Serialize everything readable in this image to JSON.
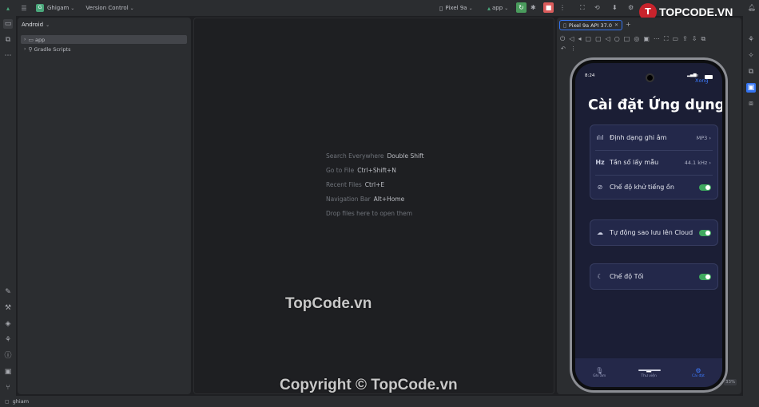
{
  "titlebar": {
    "project_initial": "G",
    "project_name": "Ghigam",
    "vcs": "Version Control",
    "device": "Pixel 9a",
    "run_config": "app"
  },
  "project_panel": {
    "view_mode": "Android",
    "tree": [
      {
        "label": "app",
        "selected": true
      },
      {
        "label": "Gradle Scripts",
        "selected": false
      }
    ]
  },
  "editor_hints": [
    {
      "text": "Search Everywhere",
      "key": "Double Shift"
    },
    {
      "text": "Go to File",
      "key": "Ctrl+Shift+N"
    },
    {
      "text": "Recent Files",
      "key": "Ctrl+E"
    },
    {
      "text": "Navigation Bar",
      "key": "Alt+Home"
    },
    {
      "text": "Drop files here to open them",
      "key": ""
    }
  ],
  "emulator": {
    "tab_label": "Pixel 9a API 37.0",
    "zoom": "33%"
  },
  "phone": {
    "time": "8:24",
    "top_right": "Xong",
    "title": "Cài đặt Ứng dụng",
    "card1": [
      {
        "icon": "waveform-icon",
        "label": "Định dạng ghi âm",
        "value": "MP3"
      },
      {
        "icon": "hz-icon",
        "label": "Tần số lấy mẫu",
        "value": "44.1 kHz"
      },
      {
        "icon": "noise-icon",
        "label": "Chế độ khử tiếng ồn",
        "toggle": true
      }
    ],
    "card2": {
      "icon": "cloud-icon",
      "label": "Tự động sao lưu lên Cloud",
      "toggle": true
    },
    "card3": {
      "icon": "moon-icon",
      "label": "Chế độ Tối",
      "toggle": true
    },
    "nav": [
      {
        "icon": "mic-icon",
        "label": "Ghi âm"
      },
      {
        "icon": "folder-icon",
        "label": "Thư viện"
      },
      {
        "icon": "gear-icon",
        "label": "Cài đặt"
      }
    ]
  },
  "status": {
    "project": "ghiam"
  },
  "watermarks": {
    "center": "TopCode.vn",
    "bottom": "Copyright © TopCode.vn",
    "logo": "TOPCODE.VN"
  }
}
